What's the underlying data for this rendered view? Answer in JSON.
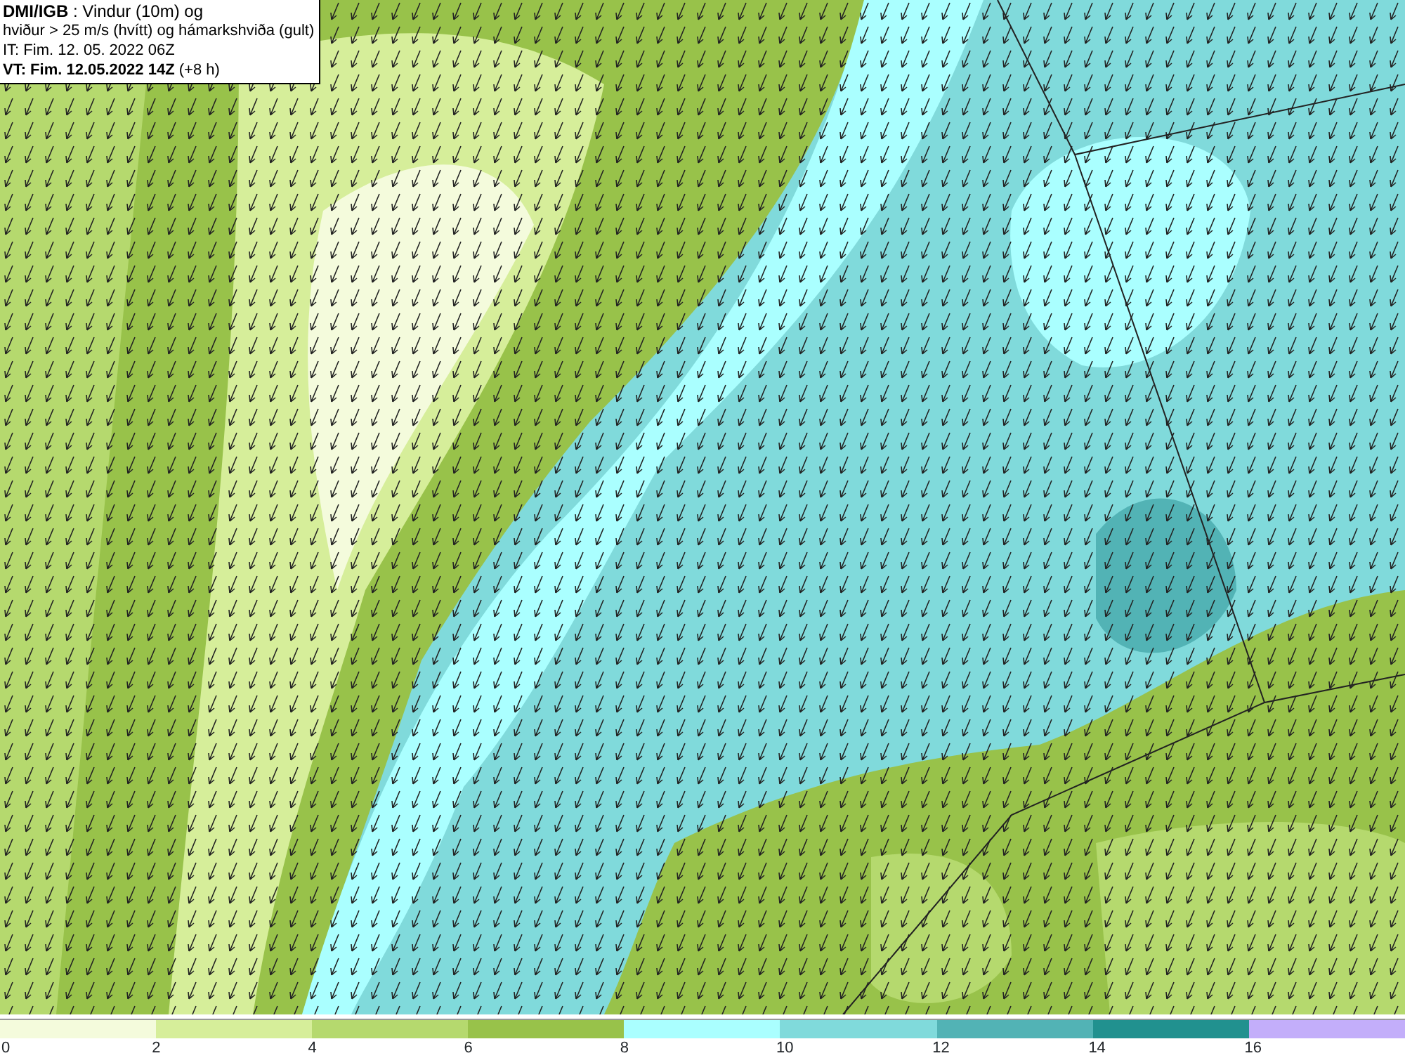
{
  "title_box": {
    "lines": [
      "**DMI/IGB** : Vindur (10m) og",
      "hviður > 25 m/s (hvítt) og hámarkshviða (gult)",
      "IT: Fim. 12. 05. 2022 06Z",
      "**VT: Fim. 12.05.2022 14Z** (+8 h)"
    ]
  },
  "legend": {
    "swatches": [
      {
        "color": "#f4fbdc"
      },
      {
        "color": "#d6ee9a"
      },
      {
        "color": "#b5d96e"
      },
      {
        "color": "#98c24a"
      },
      {
        "color": "#aaffff"
      },
      {
        "color": "#80dadb"
      },
      {
        "color": "#52b3b5"
      },
      {
        "color": "#21918f"
      },
      {
        "color": "#c3aefa"
      }
    ],
    "ticks": [
      "0",
      "2",
      "4",
      "6",
      "8",
      "10",
      "12",
      "14",
      "16"
    ]
  }
}
